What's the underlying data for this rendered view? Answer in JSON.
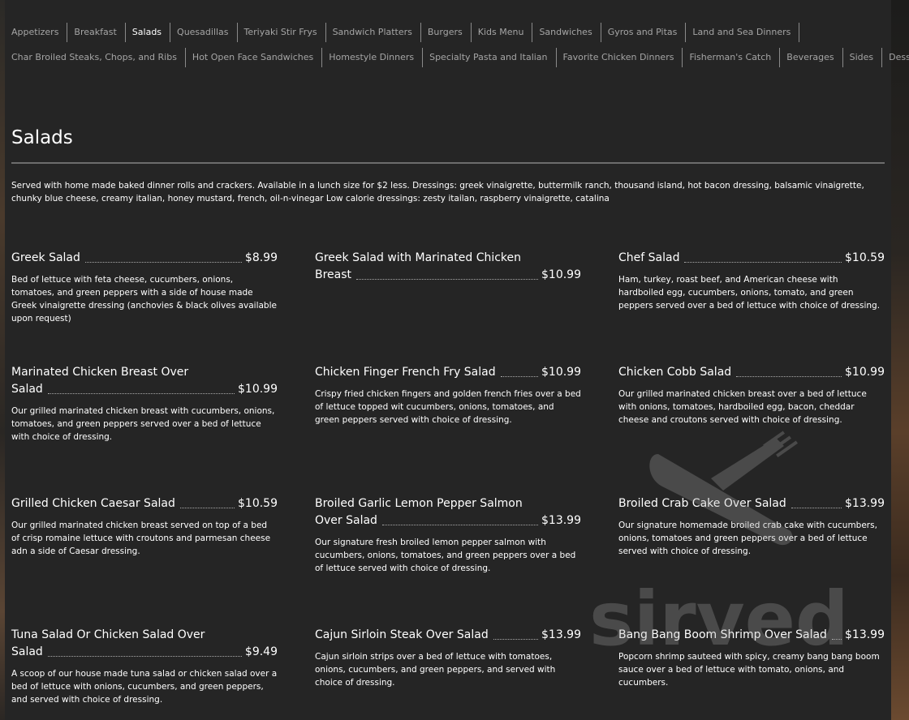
{
  "nav": {
    "row1": [
      "Appetizers",
      "Breakfast",
      "Salads",
      "Quesadillas",
      "Teriyaki Stir Frys",
      "Sandwich Platters",
      "Burgers",
      "Kids Menu",
      "Sandwiches",
      "Gyros and Pitas",
      "Land and Sea Dinners"
    ],
    "row2": [
      "Char Broiled Steaks, Chops, and Ribs",
      "Hot Open Face Sandwiches",
      "Homestyle Dinners",
      "Specialty Pasta and Italian",
      "Favorite Chicken Dinners",
      "Fisherman's Catch",
      "Beverages",
      "Sides",
      "Desserts"
    ],
    "active": "Salads"
  },
  "section": {
    "title": "Salads",
    "description": "Served with home made baked dinner rolls and crackers. Available in a lunch size for $2 less. Dressings: greek vinaigrette, buttermilk ranch, thousand island, hot bacon dressing, balsamic vinaigrette, chunky blue cheese, creamy italian, honey mustard, french, oil-n-vinegar Low calorie dressings: zesty itailan, raspberry vinaigrette, catalina"
  },
  "items": [
    {
      "name_lines": [
        "Greek Salad"
      ],
      "price": "$8.99",
      "description": "Bed of lettuce with feta cheese, cucumbers, onions, tomatoes, and green peppers with a side of house made Greek vinaigrette dressing (anchovies & black olives available upon request)"
    },
    {
      "name_lines": [
        "Greek Salad with Marinated Chicken",
        "Breast"
      ],
      "price": "$10.99",
      "description": ""
    },
    {
      "name_lines": [
        "Chef Salad"
      ],
      "price": "$10.59",
      "description": "Ham, turkey, roast beef, and American cheese with hardboiled egg, cucumbers, onions, tomato, and green peppers served over a bed of lettuce with choice of dressing."
    },
    {
      "name_lines": [
        "Marinated Chicken Breast Over",
        "Salad"
      ],
      "price": "$10.99",
      "description": "Our grilled marinated chicken breast with cucumbers, onions, tomatoes, and green peppers served over a bed of lettuce with choice of dressing."
    },
    {
      "name_lines": [
        "Chicken Finger French Fry Salad"
      ],
      "price": "$10.99",
      "description": "Crispy fried chicken fingers and golden french fries over a bed of lettuce topped wit cucumbers, onions, tomatoes, and green peppers served with choice of dressing."
    },
    {
      "name_lines": [
        "Chicken Cobb Salad"
      ],
      "price": "$10.99",
      "description": "Our grilled marinated chicken breast over a bed of lettuce with onions, tomatoes, hardboiled egg, bacon, cheddar cheese and croutons served with choice of dressing."
    },
    {
      "name_lines": [
        "Grilled Chicken Caesar Salad"
      ],
      "price": "$10.59",
      "description": "Our grilled marinated chicken breast served on top of a bed of crisp romaine lettuce with croutons and parmesan cheese adn a side of Caesar dressing."
    },
    {
      "name_lines": [
        "Broiled Garlic Lemon Pepper Salmon",
        "Over Salad"
      ],
      "price": "$13.99",
      "description": "Our signature fresh broiled lemon pepper salmon with cucumbers, onions, tomatoes, and green peppers over a bed of lettuce served with choice of dressing."
    },
    {
      "name_lines": [
        "Broiled Crab Cake Over Salad"
      ],
      "price": "$13.99",
      "description": "Our signature homemade broiled crab cake with cucumbers, onions, tomatoes and green peppers over a bed of lettuce served with choice of dressing."
    },
    {
      "name_lines": [
        "Tuna Salad Or Chicken Salad Over",
        "Salad"
      ],
      "price": "$9.49",
      "description": "A scoop of our house made tuna salad or chicken salad over a bed of lettuce with onions, cucumbers, and green peppers, and served with choice of dressing."
    },
    {
      "name_lines": [
        "Cajun Sirloin Steak Over Salad"
      ],
      "price": "$13.99",
      "description": "Cajun sirloin strips over a bed of lettuce with tomatoes, onions, cucumbers, and green peppers, and served with choice of dressing."
    },
    {
      "name_lines": [
        "Bang Bang Boom Shrimp Over Salad"
      ],
      "price": "$13.99",
      "description": "Popcorn shrimp sauteed with spicy, creamy bang bang boom sauce over a bed of lettuce with tomato, onions, and cucumbers."
    }
  ],
  "watermark": {
    "text": "sirved",
    "icon": "fork-knife-icon"
  }
}
